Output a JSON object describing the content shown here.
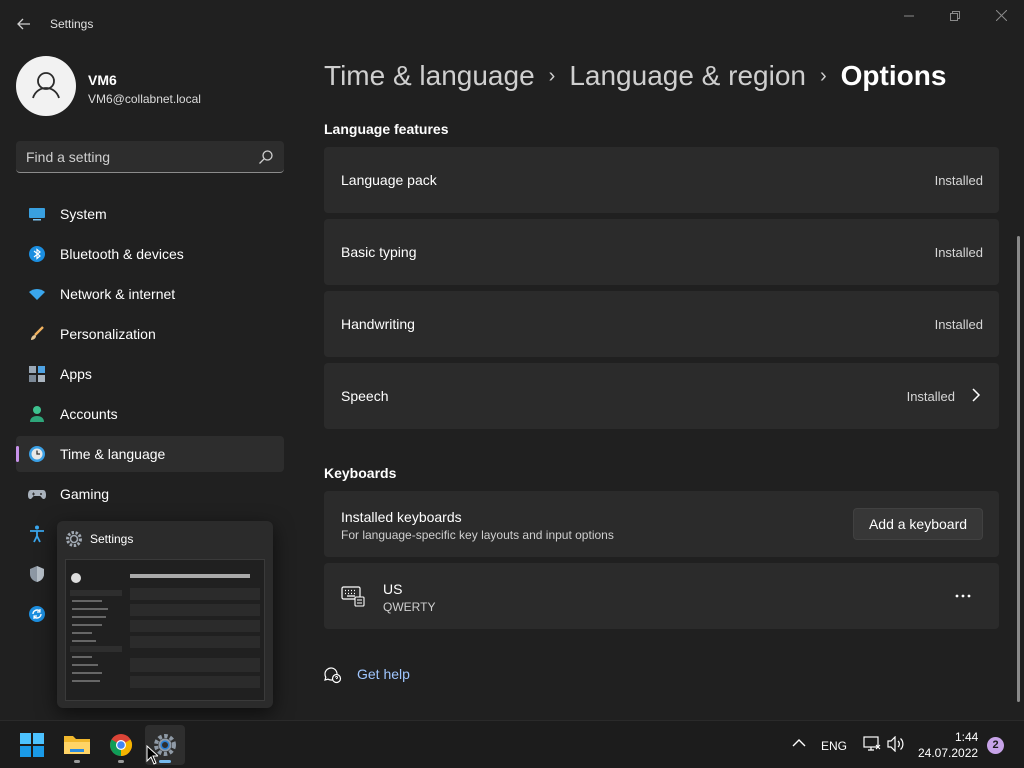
{
  "window": {
    "title": "Settings",
    "back_icon": "back-arrow-icon",
    "minimize_icon": "minimize-icon",
    "restore_icon": "restore-icon",
    "close_icon": "close-icon"
  },
  "profile": {
    "name": "VM6",
    "email": "VM6@collabnet.local"
  },
  "search": {
    "placeholder": "Find a setting"
  },
  "sidebar": {
    "items": [
      {
        "label": "System",
        "icon": "display-icon"
      },
      {
        "label": "Bluetooth & devices",
        "icon": "bluetooth-icon"
      },
      {
        "label": "Network & internet",
        "icon": "wifi-icon"
      },
      {
        "label": "Personalization",
        "icon": "brush-icon"
      },
      {
        "label": "Apps",
        "icon": "apps-icon"
      },
      {
        "label": "Accounts",
        "icon": "person-icon"
      },
      {
        "label": "Time & language",
        "icon": "clock-globe-icon",
        "active": true
      },
      {
        "label": "Gaming",
        "icon": "gamepad-icon"
      },
      {
        "label": "",
        "icon": "accessibility-icon"
      },
      {
        "label": "",
        "icon": "shield-icon"
      },
      {
        "label": "",
        "icon": "windows-update-icon"
      }
    ]
  },
  "taskbar_preview": {
    "title": "Settings"
  },
  "breadcrumb": {
    "items": [
      "Time & language",
      "Language & region"
    ],
    "current": "Options"
  },
  "language_features": {
    "title": "Language features",
    "items": [
      {
        "label": "Language pack",
        "status": "Installed"
      },
      {
        "label": "Basic typing",
        "status": "Installed"
      },
      {
        "label": "Handwriting",
        "status": "Installed"
      },
      {
        "label": "Speech",
        "status": "Installed",
        "expandable": true
      }
    ]
  },
  "keyboards": {
    "title": "Keyboards",
    "installed_title": "Installed keyboards",
    "installed_subtitle": "For language-specific key layouts and input options",
    "add_button": "Add a keyboard",
    "items": [
      {
        "name": "US",
        "layout": "QWERTY",
        "icon": "keyboard-icon"
      }
    ],
    "more_icon": "more-options-icon"
  },
  "help": {
    "label": "Get help",
    "icon": "help-chat-icon"
  },
  "taskbar": {
    "apps": [
      {
        "name": "start",
        "icon": "windows-start-icon"
      },
      {
        "name": "file-explorer",
        "icon": "folder-icon"
      },
      {
        "name": "chrome",
        "icon": "chrome-icon"
      },
      {
        "name": "settings",
        "icon": "settings-gear-icon",
        "active": true
      }
    ],
    "tray": {
      "language": "ENG",
      "time": "1:44",
      "date": "24.07.2022",
      "notifications": "2"
    }
  },
  "colors": {
    "background": "#202020",
    "card": "#2b2b2b",
    "accent": "#c792ea",
    "link": "#9fc6ff"
  }
}
